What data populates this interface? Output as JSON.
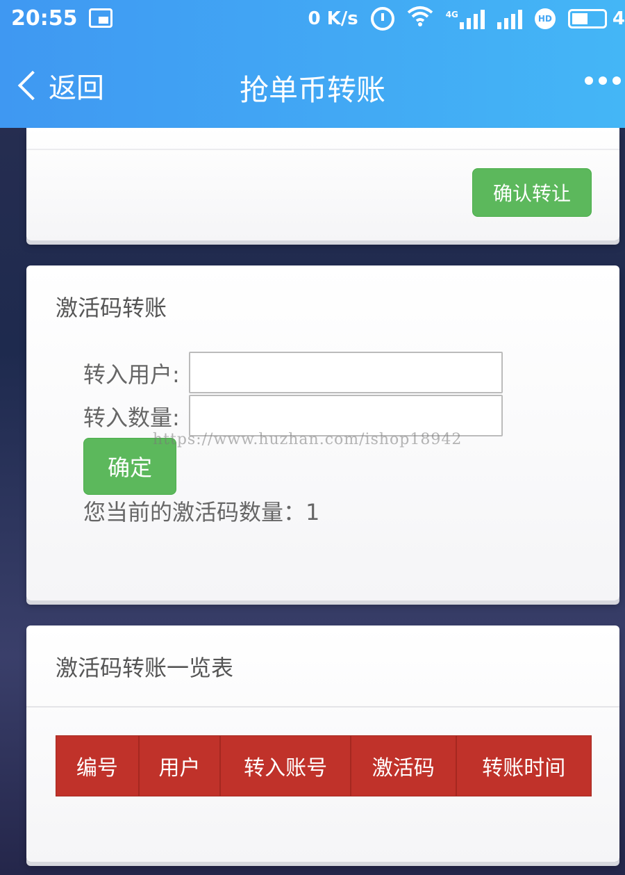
{
  "status": {
    "time": "20:55",
    "speed": "0 K/s",
    "network": "4G",
    "hd": "HD",
    "battery": "4"
  },
  "navbar": {
    "back_label": "返回",
    "title": "抢单币转账"
  },
  "card1": {
    "confirm_label": "确认转让"
  },
  "activation_transfer": {
    "title": "激活码转账",
    "user_label": "转入用户:",
    "qty_label": "转入数量:",
    "ok_label": "确定",
    "count_text": "您当前的激活码数量：1"
  },
  "watermark": "https://www.huzhan.com/ishop18942",
  "list": {
    "title": "激活码转账一览表",
    "columns": [
      "编号",
      "用户",
      "转入账号",
      "激活码",
      "转账时间"
    ]
  },
  "colors": {
    "header": "#44a6f4",
    "green_button": "#5cb85c",
    "table_header": "#c0322a"
  }
}
